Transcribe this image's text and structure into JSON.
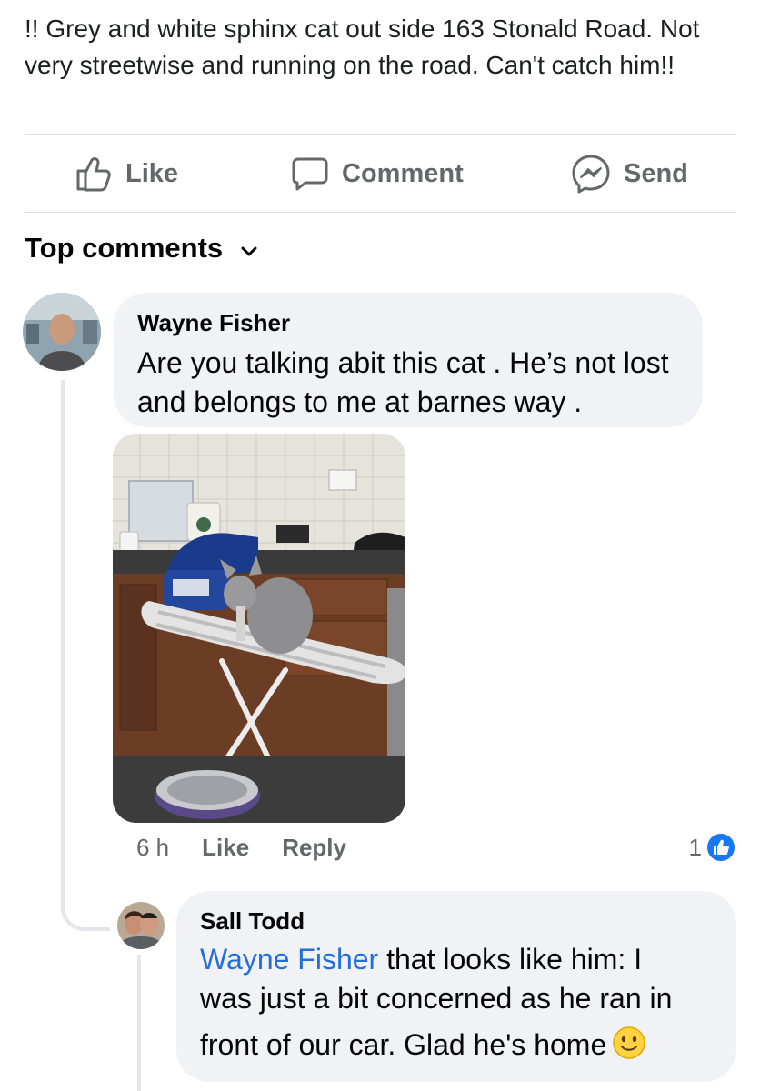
{
  "post": {
    "text": "!! Grey and white sphinx cat out side 163 Stonald Road. Not very streetwise and running on the road. Can't catch him!!"
  },
  "actions": {
    "like_label": "Like",
    "comment_label": "Comment",
    "send_label": "Send"
  },
  "comments_header": {
    "label": "Top comments"
  },
  "comments": [
    {
      "author": "Wayne Fisher",
      "text": "Are you talking abit this cat . He’s not lost and belongs to me at barnes way .",
      "time": "6 h",
      "like_label": "Like",
      "reply_label": "Reply",
      "reaction_count": "1"
    }
  ],
  "replies": [
    {
      "author": "Sall Todd",
      "mention": "Wayne Fisher",
      "text_line1": " that looks like him: I",
      "text_line2": "was just a bit concerned as he ran in",
      "text_line3": "front of our car.  Glad he's home"
    }
  ],
  "colors": {
    "text_primary": "#050505",
    "text_secondary": "#65676b",
    "bubble_bg": "#f0f2f5",
    "mention": "#216fdb",
    "like_blue": "#1877f2"
  }
}
